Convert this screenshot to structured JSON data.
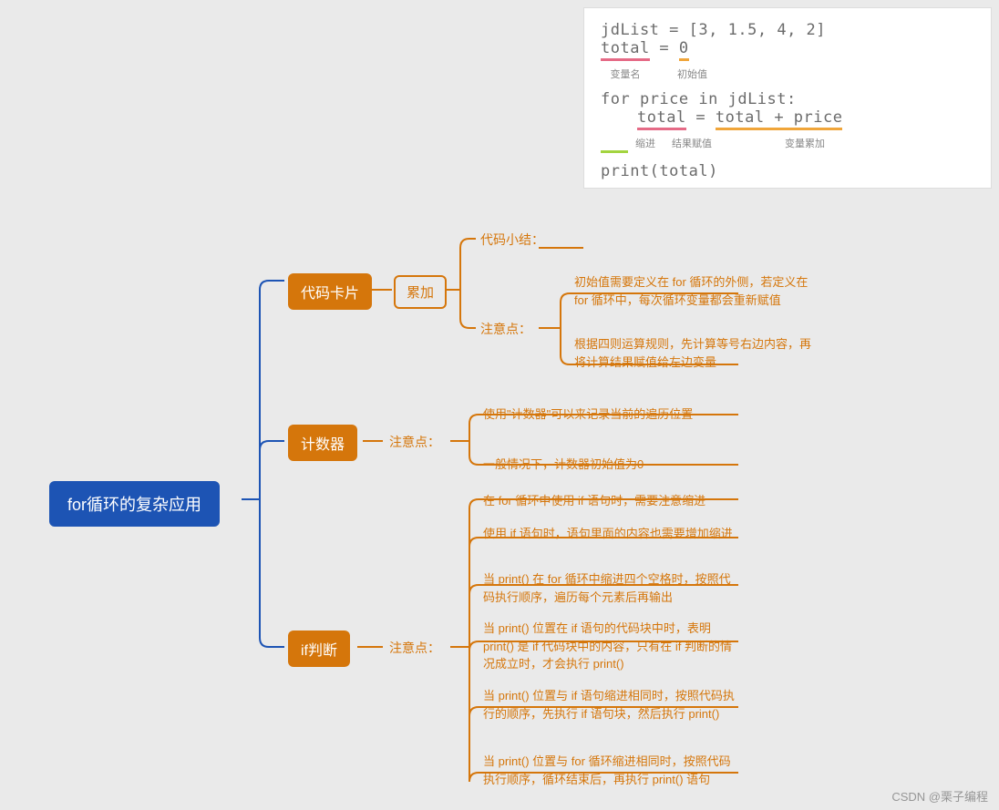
{
  "root": "for循环的复杂应用",
  "branches": {
    "b1": "代码卡片",
    "b2": "计数器",
    "b3": "if判断"
  },
  "sub": {
    "s1": "累加"
  },
  "labels": {
    "code_summary": "代码小结：",
    "notes": "注意点："
  },
  "leaves": {
    "acc1": "初始值需要定义在 for 循环的外侧，若定义在 for 循环中，每次循环变量都会重新赋值",
    "acc2": "根据四则运算规则，先计算等号右边内容，再将计算结果赋值给左边变量",
    "cnt1": "使用\"计数器\"可以来记录当前的遍历位置",
    "cnt2": "一般情况下，计数器初始值为0",
    "if1": "在 for 循环中使用 if 语句时，需要注意缩进",
    "if2": "使用 if 语句时，语句里面的内容也需要增加缩进",
    "if3": "当 print() 在 for 循环中缩进四个空格时，按照代码执行顺序，遍历每个元素后再输出",
    "if4": "当 print() 位置在 if 语句的代码块中时，表明 print() 是 if 代码块中的内容，只有在 if 判断的情况成立时，才会执行 print()",
    "if5": "当 print() 位置与 if 语句缩进相同时，按照代码执行的顺序，先执行 if 语句块，然后执行 print()",
    "if6": "当 print() 位置与 for 循环缩进相同时，按照代码执行顺序，循环结束后，再执行 print() 语句"
  },
  "code": {
    "line1a": "jdList",
    "line1b": " = [",
    "line1c": "3",
    "line1d": ", ",
    "line1e": "1.5",
    "line1f": ", ",
    "line1g": "4",
    "line1h": ", ",
    "line1i": "2",
    "line1j": "]",
    "line2a": "total",
    "line2b": " = ",
    "line2c": "0",
    "anno1a": "变量名",
    "anno1b": "初始值",
    "line3a": "for",
    "line3b": " price ",
    "line3c": "in",
    "line3d": " jdList:",
    "line4a": "total",
    "line4b": " = ",
    "line4c": "total + price",
    "anno2a": "缩进",
    "anno2b": "结果赋值",
    "anno2c": "变量累加",
    "line5": "print(total)"
  },
  "watermark": "CSDN @栗子编程",
  "colors": {
    "blue": "#1d54b4",
    "orange": "#d5760b",
    "pink": "#e56a86",
    "yellow": "#f0a53a",
    "green": "#a3d43f"
  }
}
